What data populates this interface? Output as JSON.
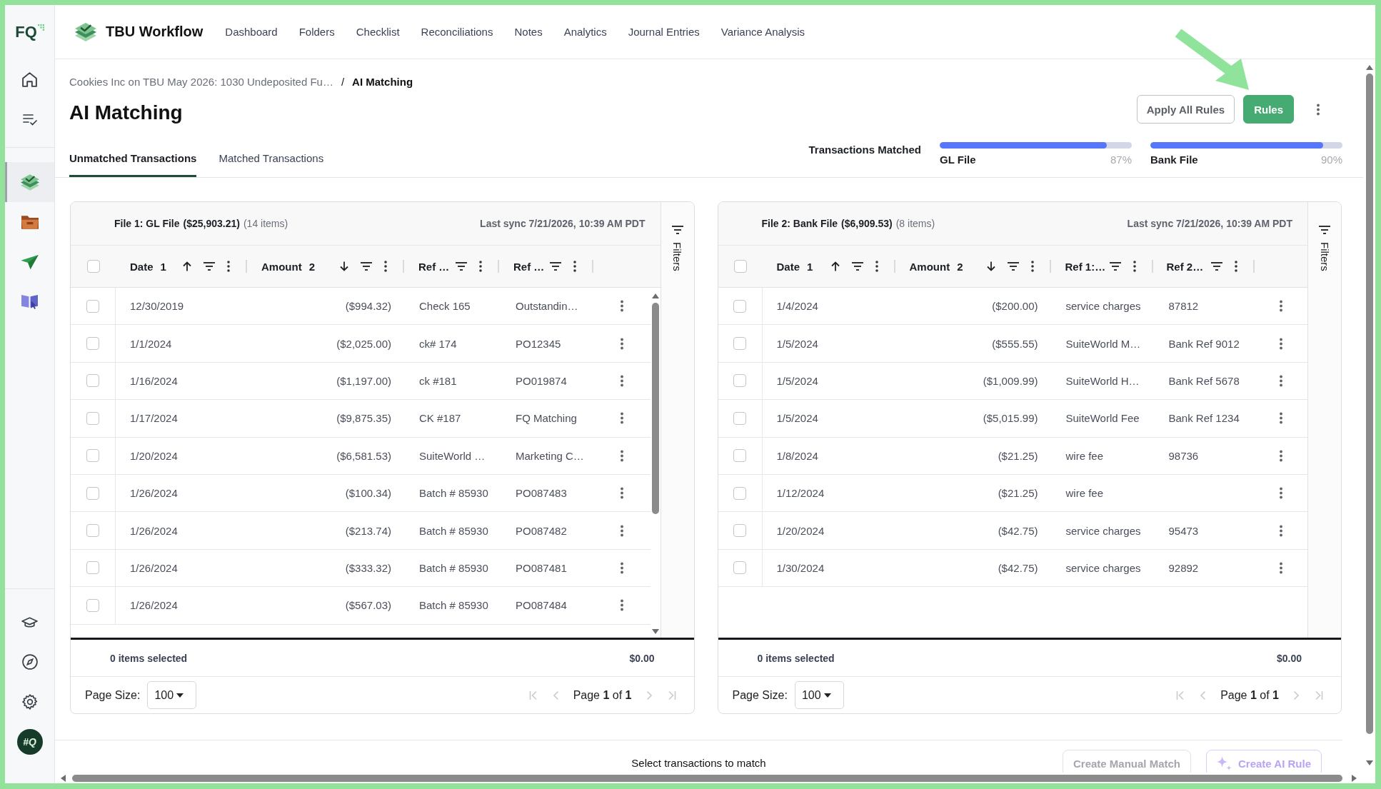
{
  "sidebar": {
    "logo": "FQ",
    "items": [
      {
        "selected": false
      },
      {
        "selected": false
      }
    ],
    "apps": [
      {
        "selected": true
      },
      {
        "selected": false
      },
      {
        "selected": false
      },
      {
        "selected": false
      }
    ],
    "utilities": [
      {
        "selected": false
      },
      {
        "selected": false
      },
      {
        "selected": false
      }
    ],
    "avatar": "#Q"
  },
  "nav": {
    "app_title": "TBU Workflow",
    "items": [
      {
        "label": "Dashboard",
        "selected": false
      },
      {
        "label": "Folders",
        "selected": false
      },
      {
        "label": "Checklist",
        "selected": false
      },
      {
        "label": "Reconciliations",
        "selected": false
      },
      {
        "label": "Notes",
        "selected": false
      },
      {
        "label": "Analytics",
        "selected": false
      },
      {
        "label": "Journal Entries",
        "selected": false
      },
      {
        "label": "Variance Analysis",
        "selected": false
      }
    ]
  },
  "page": {
    "breadcrumb": [
      {
        "label": "Cookies Inc on TBU May 2026: 1030 Undeposited Fu…",
        "current": false
      },
      {
        "label": "AI Matching",
        "current": true
      }
    ],
    "separator": "/",
    "title": "AI Matching"
  },
  "actions": [
    {
      "label": "Apply All Rules",
      "kind": "secondary"
    },
    {
      "label": "Rules",
      "kind": "primary"
    }
  ],
  "tabs": [
    {
      "label": "Unmatched Transactions",
      "selected": true
    },
    {
      "label": "Matched Transactions",
      "selected": false
    }
  ],
  "matched": {
    "label": "Transactions Matched",
    "files": [
      {
        "name": "GL File",
        "level": 0.87,
        "reading": "87%"
      },
      {
        "name": "Bank File",
        "level": 0.9,
        "reading": "90%"
      }
    ]
  },
  "panels": [
    {
      "title": "File 1: GL File",
      "total": "($25,903.21)",
      "count": "(14 items)",
      "sync": "Last sync 7/21/2026, 10:39 AM PDT",
      "select_all_checked": false,
      "columns": [
        {
          "label": "Date",
          "sort_order": "1",
          "sorted": true,
          "descending": false
        },
        {
          "label": "Amount",
          "sort_order": "2",
          "sorted": true,
          "descending": true
        },
        {
          "label": "Ref …",
          "sorted": false
        },
        {
          "label": "Ref …",
          "sorted": false
        }
      ],
      "rows": [
        {
          "checked": false,
          "date": "12/30/2019",
          "amount": "($994.32)",
          "ref_1": "Check 165",
          "ref_2": "Outstandin…"
        },
        {
          "checked": false,
          "date": "1/1/2024",
          "amount": "($2,025.00)",
          "ref_1": "ck# 174",
          "ref_2": "PO12345"
        },
        {
          "checked": false,
          "date": "1/16/2024",
          "amount": "($1,197.00)",
          "ref_1": "ck #181",
          "ref_2": "PO019874"
        },
        {
          "checked": false,
          "date": "1/17/2024",
          "amount": "($9,875.35)",
          "ref_1": "CK #187",
          "ref_2": "FQ Matching"
        },
        {
          "checked": false,
          "date": "1/20/2024",
          "amount": "($6,581.53)",
          "ref_1": "SuiteWorld …",
          "ref_2": "Marketing C…"
        },
        {
          "checked": false,
          "date": "1/26/2024",
          "amount": "($100.34)",
          "ref_1": "Batch # 85930",
          "ref_2": "PO087483"
        },
        {
          "checked": false,
          "date": "1/26/2024",
          "amount": "($213.74)",
          "ref_1": "Batch # 85930",
          "ref_2": "PO087482"
        },
        {
          "checked": false,
          "date": "1/26/2024",
          "amount": "($333.32)",
          "ref_1": "Batch # 85930",
          "ref_2": "PO087481"
        },
        {
          "checked": false,
          "date": "1/26/2024",
          "amount": "($567.03)",
          "ref_1": "Batch # 85930",
          "ref_2": "PO087484"
        }
      ],
      "scrollable": true,
      "filters_label": "Filters",
      "selected_summary": "0 items selected",
      "selected_total": "$0.00",
      "page_size_label": "Page Size:",
      "page_size": "100",
      "page_label": "Page **1** of **1**",
      "page_nav_disabled": true
    },
    {
      "title": "File 2: Bank File",
      "total": "($6,909.53)",
      "count": "(8 items)",
      "sync": "Last sync 7/21/2026, 10:39 AM PDT",
      "select_all_checked": false,
      "columns": [
        {
          "label": "Date",
          "sort_order": "1",
          "sorted": true,
          "descending": false
        },
        {
          "label": "Amount",
          "sort_order": "2",
          "sorted": true,
          "descending": true
        },
        {
          "label": "Ref 1:…",
          "sorted": false
        },
        {
          "label": "Ref 2…",
          "sorted": false
        }
      ],
      "rows": [
        {
          "checked": false,
          "date": "1/4/2024",
          "amount": "($200.00)",
          "ref_1": "service charges",
          "ref_2": "87812"
        },
        {
          "checked": false,
          "date": "1/5/2024",
          "amount": "($555.55)",
          "ref_1": "SuiteWorld M…",
          "ref_2": "Bank Ref 9012"
        },
        {
          "checked": false,
          "date": "1/5/2024",
          "amount": "($1,009.99)",
          "ref_1": "SuiteWorld H…",
          "ref_2": "Bank Ref 5678"
        },
        {
          "checked": false,
          "date": "1/5/2024",
          "amount": "($5,015.99)",
          "ref_1": "SuiteWorld Fee",
          "ref_2": "Bank Ref 1234"
        },
        {
          "checked": false,
          "date": "1/8/2024",
          "amount": "($21.25)",
          "ref_1": "wire fee",
          "ref_2": "98736"
        },
        {
          "checked": false,
          "date": "1/12/2024",
          "amount": "($21.25)",
          "ref_1": "wire fee"
        },
        {
          "checked": false,
          "date": "1/20/2024",
          "amount": "($42.75)",
          "ref_1": "service charges",
          "ref_2": "95473"
        },
        {
          "checked": false,
          "date": "1/30/2024",
          "amount": "($42.75)",
          "ref_1": "service charges",
          "ref_2": "92892"
        }
      ],
      "scrollable": false,
      "filters_label": "Filters",
      "selected_summary": "0 items selected",
      "selected_total": "$0.00",
      "page_size_label": "Page Size:",
      "page_size": "100",
      "page_label": "Page **1** of **1**",
      "page_nav_disabled": true
    }
  ],
  "bottom": {
    "hint": "Select transactions to match",
    "buttons": [
      {
        "label": "Create Manual Match",
        "kind": "manual",
        "disabled": true
      },
      {
        "label": "Create AI Rule",
        "kind": "ai",
        "disabled": true
      }
    ]
  }
}
